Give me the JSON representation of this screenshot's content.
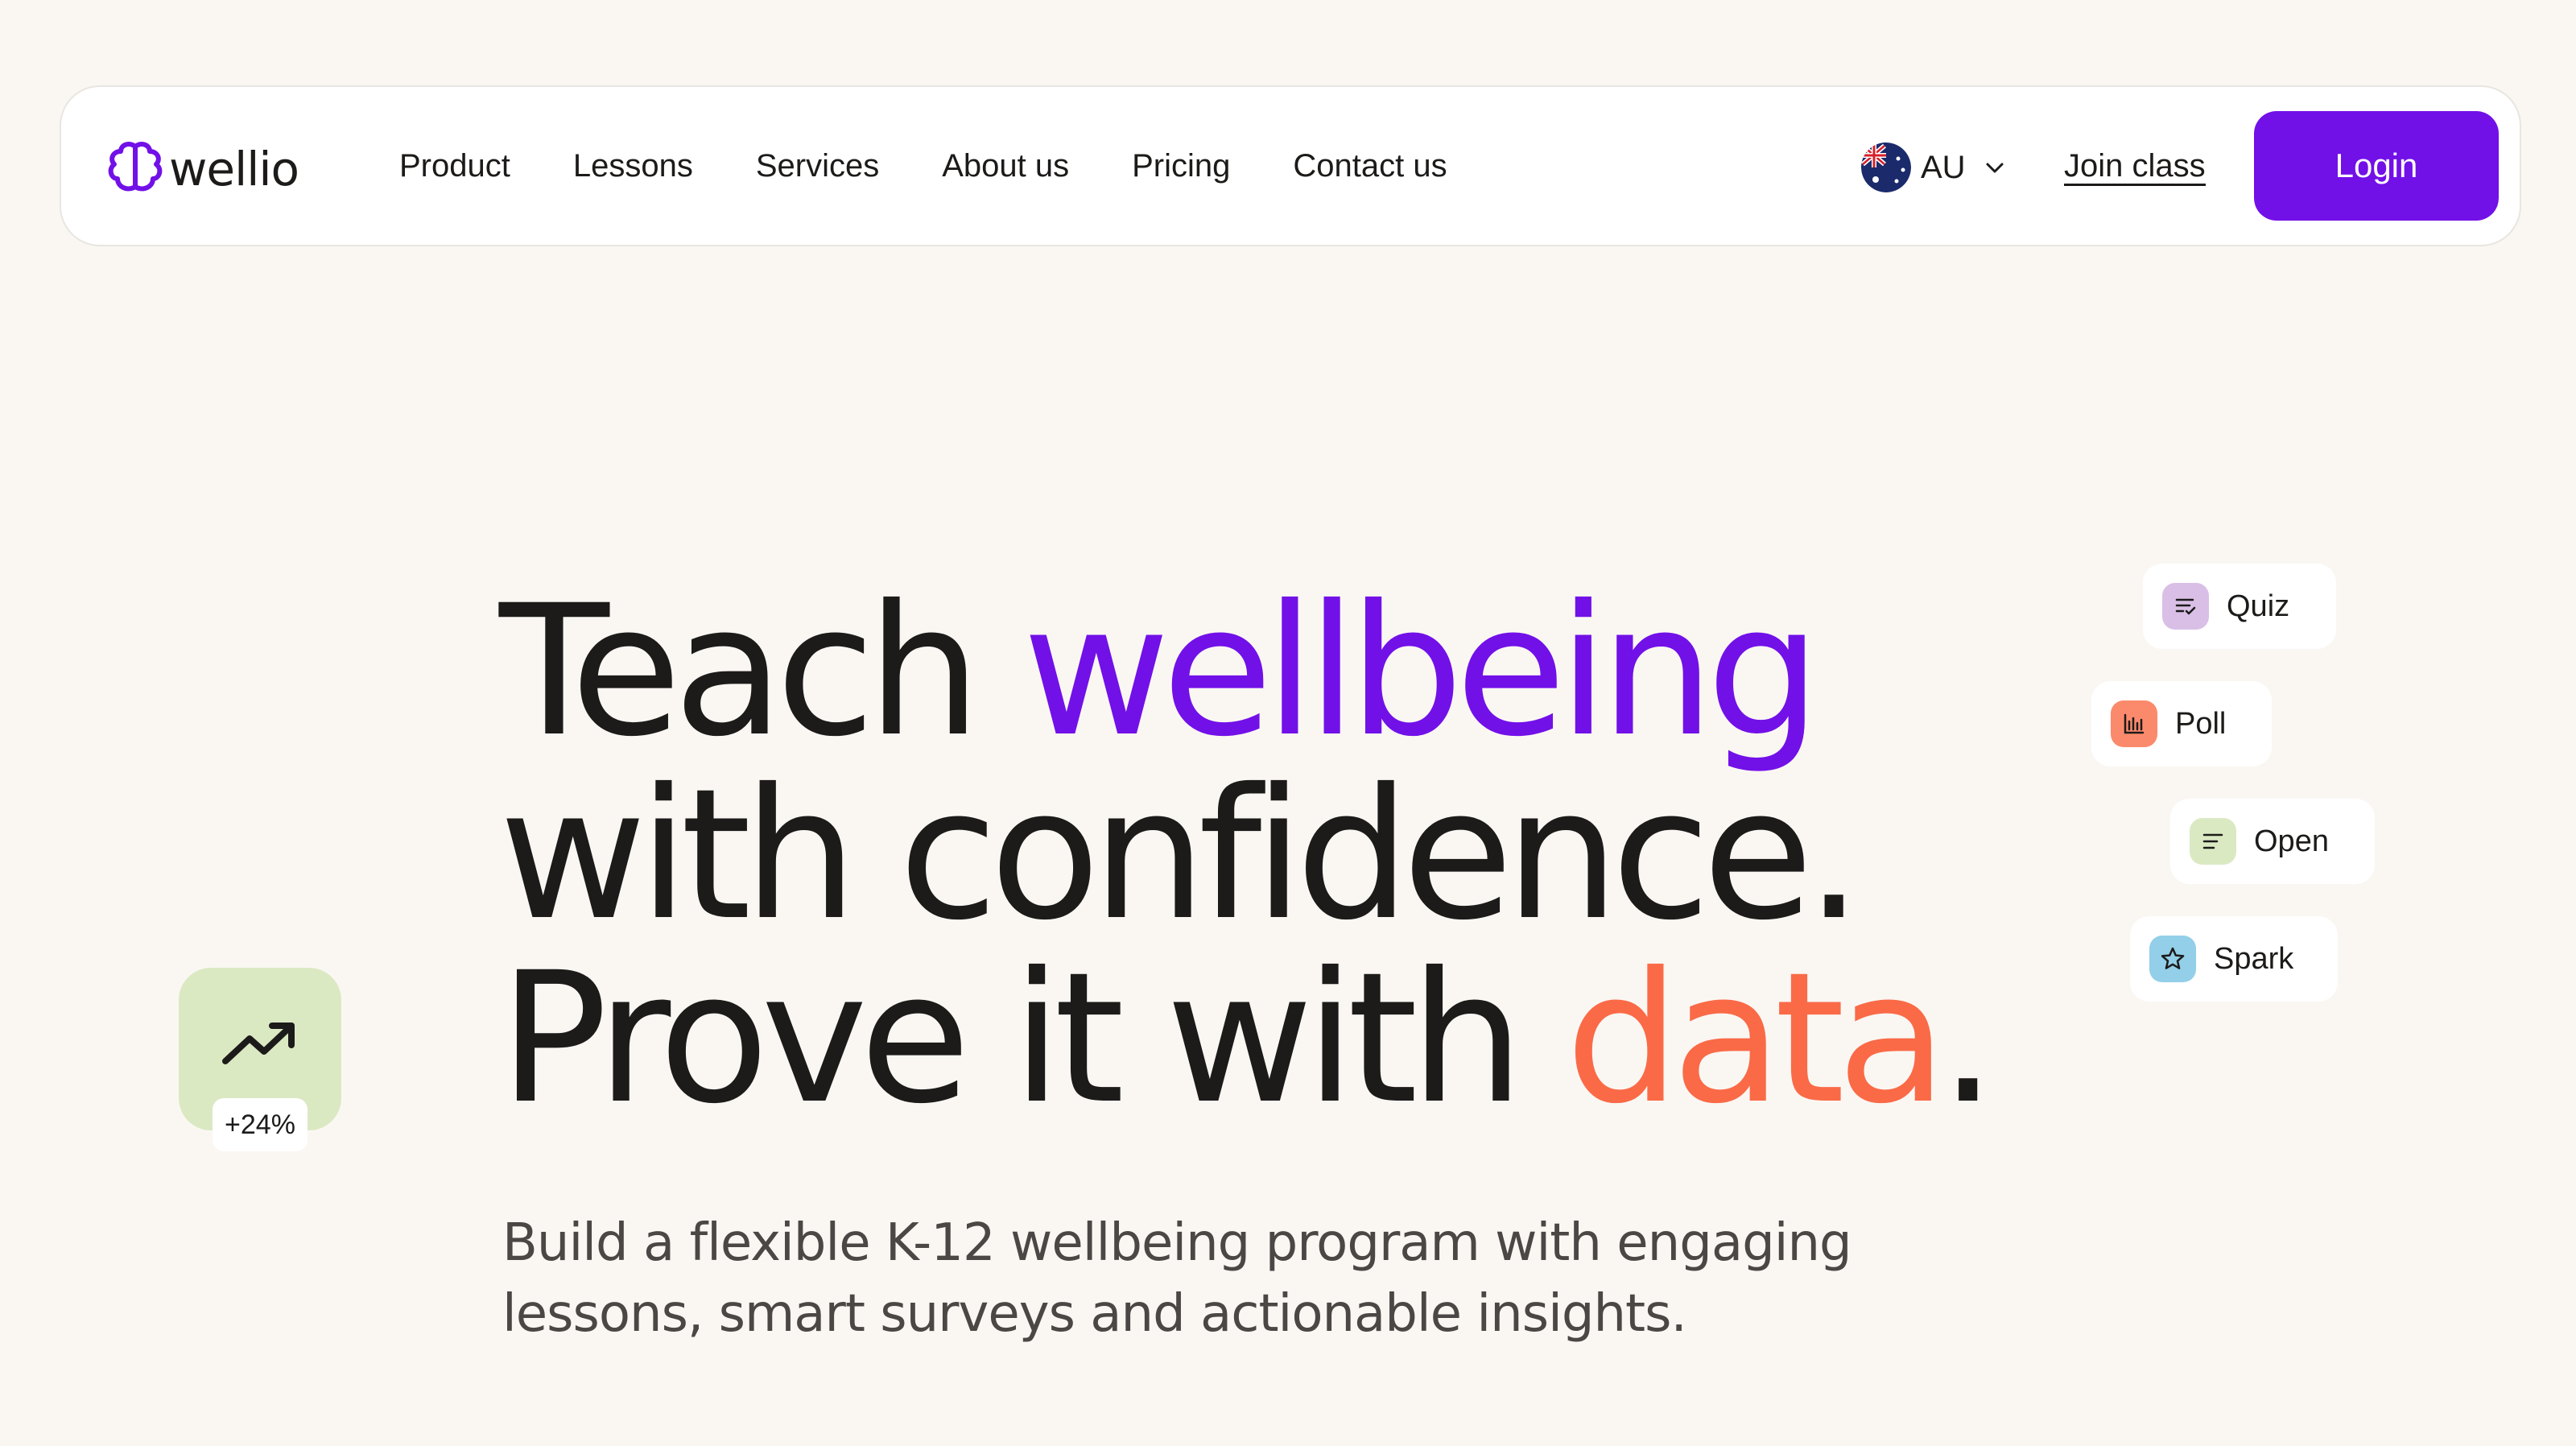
{
  "brand": {
    "name": "wellio",
    "accent": "#7210e8"
  },
  "nav": {
    "links": [
      "Product",
      "Lessons",
      "Services",
      "About us",
      "Pricing",
      "Contact us"
    ],
    "region": {
      "code": "AU",
      "flag_icon": "australia-flag-icon"
    },
    "join_label": "Join class",
    "login_label": "Login"
  },
  "hero": {
    "line1_a": "Teach ",
    "line1_b": "wellbeing",
    "line2": "with confidence.",
    "line3_a": "Prove it with ",
    "line3_b": "data",
    "line3_c": ".",
    "subtitle": "Build a flexible K-12 wellbeing program with engaging lessons, smart surveys and actionable insights.",
    "colors": {
      "purple": "#7210e8",
      "orange": "#fa6a47",
      "text": "#1c1b1a"
    }
  },
  "stat": {
    "value": "+24%",
    "icon": "trending-up-icon",
    "bg": "#dbe9c3"
  },
  "chips": [
    {
      "label": "Quiz",
      "icon": "checklist-icon",
      "bg": "#d9bfe6"
    },
    {
      "label": "Poll",
      "icon": "bar-chart-icon",
      "bg": "#fb8a6c"
    },
    {
      "label": "Open",
      "icon": "text-lines-icon",
      "bg": "#dbe9c3"
    },
    {
      "label": "Spark",
      "icon": "star-icon",
      "bg": "#93cfe8"
    }
  ]
}
